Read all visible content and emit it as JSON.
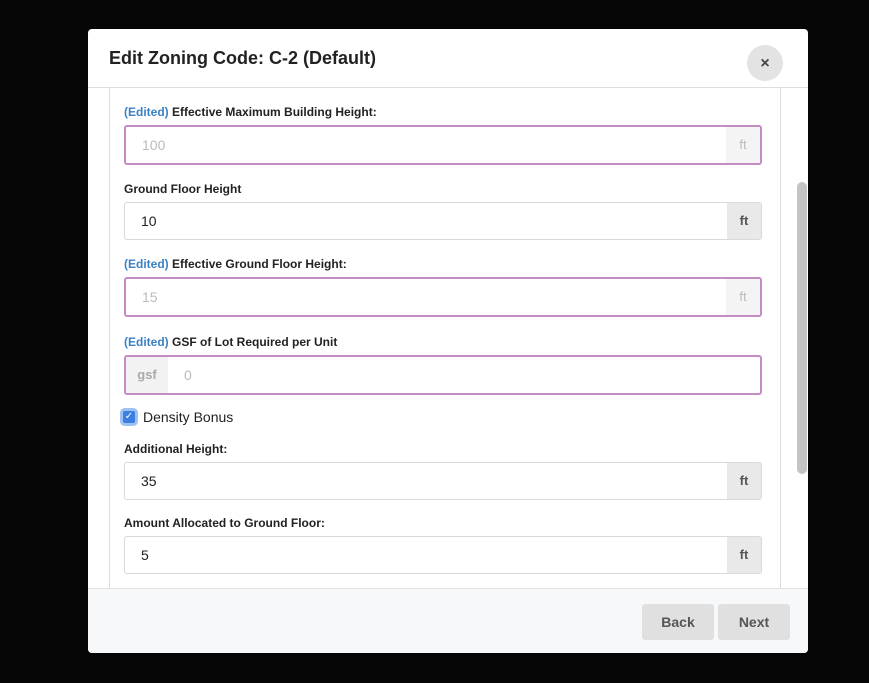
{
  "modal": {
    "title": "Edit Zoning Code: C-2 (Default)",
    "close_icon": "×"
  },
  "edited_tag": "(Edited)",
  "fields": [
    {
      "label": "Effective Maximum Building Height:",
      "value": "100",
      "unit": "ft"
    },
    {
      "label": "Ground Floor Height",
      "value": "10",
      "unit": "ft"
    },
    {
      "label": "Effective Ground Floor Height:",
      "value": "15",
      "unit": "ft"
    },
    {
      "label": "GSF of Lot Required per Unit",
      "value": "0",
      "unit": "gsf"
    },
    {
      "label": "Additional Height:",
      "value": "35",
      "unit": "ft"
    },
    {
      "label": "Amount Allocated to Ground Floor:",
      "value": "5",
      "unit": "ft"
    }
  ],
  "density_bonus": {
    "label": "Density Bonus",
    "checked": true
  },
  "footer": {
    "back": "Back",
    "next": "Next"
  }
}
